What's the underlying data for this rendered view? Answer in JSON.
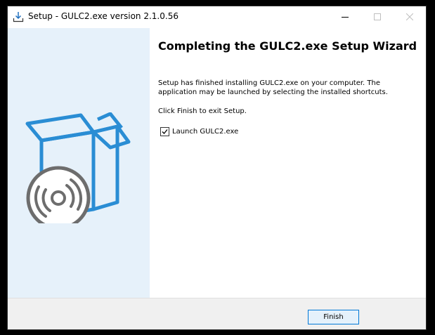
{
  "window": {
    "title": "Setup - GULC2.exe version 2.1.0.56"
  },
  "wizard": {
    "title": "Completing the GULC2.exe Setup Wizard",
    "paragraph1": "Setup has finished installing GULC2.exe on your computer. The application may be launched by selecting the installed shortcuts.",
    "paragraph2": "Click Finish to exit Setup.",
    "launch_option": {
      "label": "Launch GULC2.exe",
      "checked": true
    }
  },
  "footer": {
    "finish_label": "Finish"
  },
  "icons": {
    "title": "setup-download-icon",
    "minimize": "minimize-icon",
    "maximize": "maximize-icon",
    "close": "close-icon",
    "side_art": "software-box-disc-icon",
    "check": "checkmark-icon"
  },
  "colors": {
    "side_panel": "#e6f1fa",
    "box_outline": "#2a8dd4",
    "disc": "#6d6d6d",
    "button_border": "#0078d7",
    "button_fill": "#e5f1fb"
  }
}
